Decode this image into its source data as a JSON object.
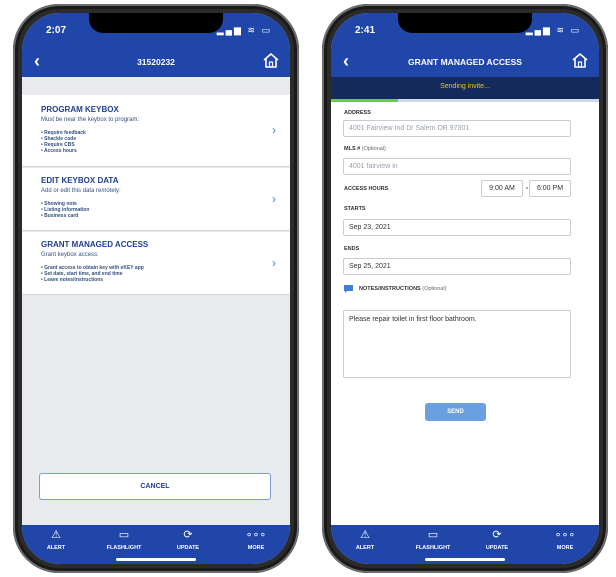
{
  "left": {
    "status_time": "2:07",
    "status_icons": "▂▄▆ ≋ ▭",
    "title": "31520232",
    "menu": [
      {
        "title": "PROGRAM KEYBOX",
        "subtitle": "Must be near the keybox to program:",
        "bullets": [
          "• Require feedback",
          "• Shackle code",
          "• Require CBS",
          "• Access hours"
        ]
      },
      {
        "title": "EDIT KEYBOX DATA",
        "subtitle": "Add or edit this data remotely:",
        "bullets": [
          "• Showing note",
          "• Listing information",
          "• Business card"
        ]
      },
      {
        "title": "GRANT MANAGED ACCESS",
        "subtitle": "Grant keybox access:",
        "bullets": [
          "• Grant access to obtain key with eKEY app",
          "• Set date, start time, and end time",
          "• Leave notes/instructions"
        ]
      }
    ],
    "cancel_label": "CANCEL"
  },
  "right": {
    "status_time": "2:41",
    "status_icons": "▂▄▆ ≋ ▭",
    "title": "GRANT MANAGED ACCESS",
    "sending_text": "Sending invite...",
    "progress": 0.25,
    "address_label": "ADDRESS",
    "address_value": "4001 Fairview Ind Dr  Salem OR 97301",
    "mls_label": "MLS #",
    "mls_optional": "(Optional)",
    "mls_value": "4001 fairview in",
    "access_hours_label": "ACCESS HOURS",
    "access_start": "9:00 AM",
    "access_sep": "-",
    "access_end": "6:00 PM",
    "starts_label": "STARTS",
    "starts_value": "Sep 23, 2021",
    "ends_label": "ENDS",
    "ends_value": "Sep 25, 2021",
    "notes_label": "NOTES/INSTRUCTIONS",
    "notes_optional": "(Optional)",
    "notes_value": "Please repair toilet in first floor bathroom.",
    "send_label": "SEND"
  },
  "tabs": [
    {
      "label": "ALERT",
      "icon": "alert-triangle-icon",
      "glyph": "⚠"
    },
    {
      "label": "FLASHLIGHT",
      "icon": "flashlight-icon",
      "glyph": "▭"
    },
    {
      "label": "UPDATE",
      "icon": "update-sync-icon",
      "glyph": "⟳"
    },
    {
      "label": "MORE",
      "icon": "more-dots-icon",
      "glyph": "∘∘∘"
    }
  ],
  "colors": {
    "brand_blue": "#1f46a8",
    "banner_dark": "#152a5c",
    "sending_yellow": "#f1c40f",
    "progress_green": "#6ecb3f",
    "send_button": "#6a9fe0"
  }
}
